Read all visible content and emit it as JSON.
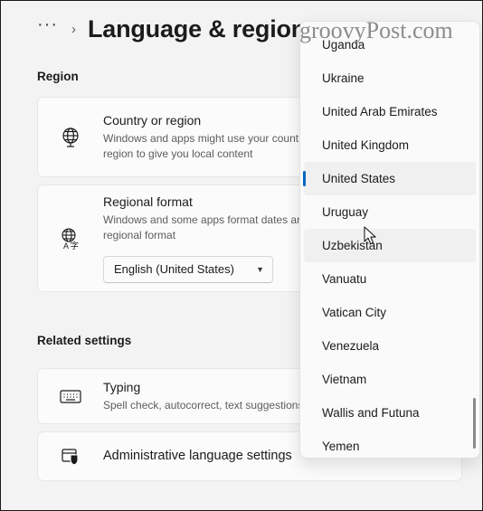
{
  "header": {
    "breadcrumb_overflow": "···",
    "breadcrumb_separator": "›",
    "title": "Language & region"
  },
  "watermark": "groovyPost.com",
  "sections": {
    "region_heading": "Region",
    "related_heading": "Related settings"
  },
  "cards": {
    "country": {
      "icon": "globe-icon",
      "title": "Country or region",
      "subtitle": "Windows and apps might use your country or region to give you local content"
    },
    "regional": {
      "icon": "globe-language-icon",
      "title": "Regional format",
      "subtitle": "Windows and some apps format dates and regional format",
      "combo_value": "English (United States)",
      "combo_chevron": "⌄"
    },
    "typing": {
      "icon": "keyboard-icon",
      "title": "Typing",
      "subtitle": "Spell check, autocorrect, text suggestions"
    },
    "admin": {
      "icon": "window-shield-icon",
      "title": "Administrative language settings"
    }
  },
  "dropdown": {
    "accent_color": "#0067C0",
    "selected": "United States",
    "hovered": "Uzbekistan",
    "items": [
      {
        "label": "Uganda",
        "state": "normal"
      },
      {
        "label": "Ukraine",
        "state": "normal"
      },
      {
        "label": "United Arab Emirates",
        "state": "normal"
      },
      {
        "label": "United Kingdom",
        "state": "normal"
      },
      {
        "label": "United States",
        "state": "selected"
      },
      {
        "label": "Uruguay",
        "state": "normal"
      },
      {
        "label": "Uzbekistan",
        "state": "hover"
      },
      {
        "label": "Vanuatu",
        "state": "normal"
      },
      {
        "label": "Vatican City",
        "state": "normal"
      },
      {
        "label": "Venezuela",
        "state": "normal"
      },
      {
        "label": "Vietnam",
        "state": "normal"
      },
      {
        "label": "Wallis and Futuna",
        "state": "normal"
      },
      {
        "label": "Yemen",
        "state": "normal"
      }
    ]
  }
}
